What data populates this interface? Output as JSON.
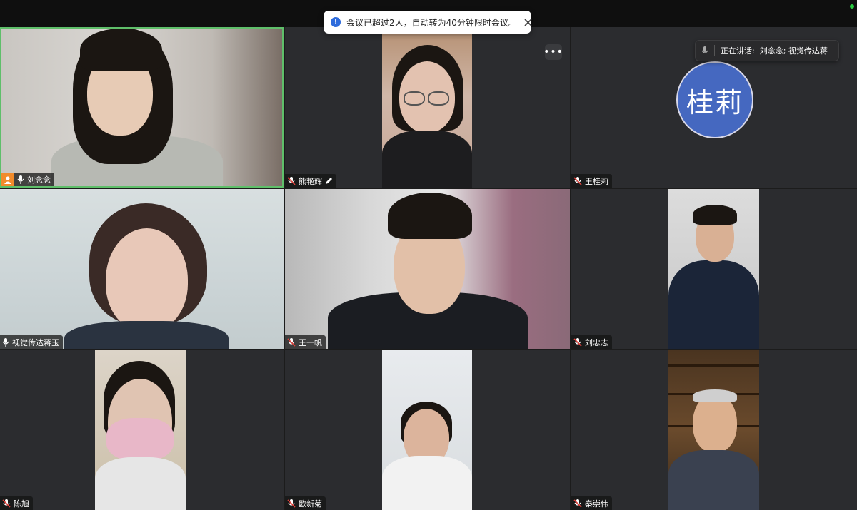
{
  "toast": {
    "message": "会议已超过2人，自动转为40分钟限时会议。"
  },
  "speaking_indicator": {
    "label": "正在讲话:",
    "speakers": "刘念念; 视觉传达蒋..."
  },
  "participants": [
    {
      "name": "刘念念",
      "is_host": true,
      "active_speaker": true,
      "muted": false
    },
    {
      "name": "熊艳辉",
      "muted": true,
      "renamable": true
    },
    {
      "name": "王桂莉",
      "muted": true,
      "avatar_text": "桂莉",
      "avatar_color": "#4568c0",
      "video_off": true
    },
    {
      "name": "视觉传达蒋玉",
      "muted": false
    },
    {
      "name": "王一帆",
      "muted": true
    },
    {
      "name": "刘忠志",
      "muted": true
    },
    {
      "name": "陈旭",
      "muted": true
    },
    {
      "name": "欧新菊",
      "muted": true
    },
    {
      "name": "秦崇伟",
      "muted": true
    }
  ],
  "colors": {
    "active_border": "#5fbf6a",
    "host_badge": "#f28b2b",
    "tile_bg": "#2b2c2f",
    "muted_icon": "#e0403a"
  }
}
